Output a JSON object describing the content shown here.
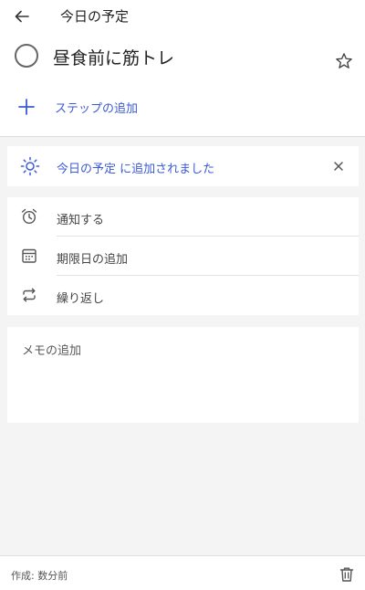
{
  "header": {
    "title": "今日の予定",
    "back_icon": "arrow-left-icon"
  },
  "task": {
    "title": "昼食前に筋トレ",
    "completed": false,
    "starred": false
  },
  "steps": {
    "add_label": "ステップの追加"
  },
  "my_day": {
    "text": "今日の予定 に追加されました",
    "icon": "sun-icon"
  },
  "options": {
    "reminder_label": "通知する",
    "due_label": "期限日の追加",
    "repeat_label": "繰り返し"
  },
  "note": {
    "placeholder": "メモの追加",
    "value": ""
  },
  "footer": {
    "created": "作成: 数分前"
  },
  "colors": {
    "accent": "#3c5bd6",
    "background": "#f4f4f4",
    "card": "#ffffff"
  }
}
